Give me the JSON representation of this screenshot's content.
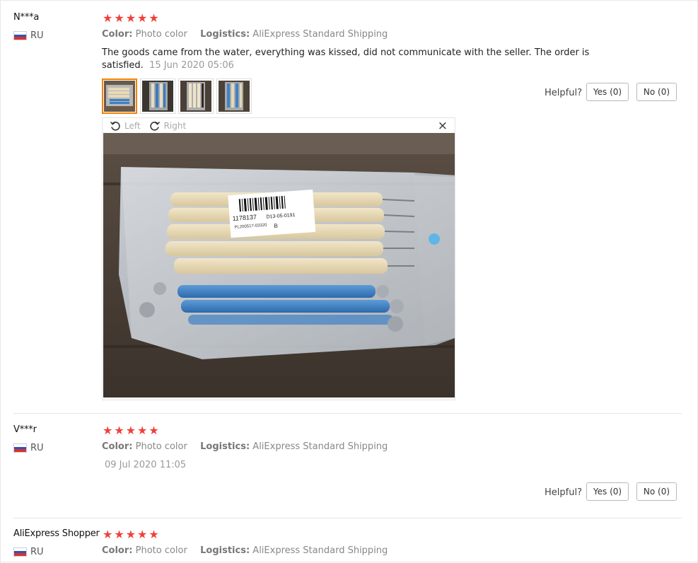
{
  "labels": {
    "color": "Color:",
    "logistics": "Logistics:",
    "helpful": "Helpful?",
    "rotate_left": "Left",
    "rotate_right": "Right",
    "close": "×"
  },
  "reviews": [
    {
      "user": "N***a",
      "country": "RU",
      "rating": 5,
      "color_value": "Photo color",
      "logistics_value": "AliExpress Standard Shipping",
      "text": "The goods came from the water, everything was kissed, did not communicate with the seller. The order is satisfied.",
      "date": "15 Jun 2020 05:06",
      "yes": "Yes (0)",
      "no": "No (0)"
    },
    {
      "user": "V***r",
      "country": "RU",
      "rating": 5,
      "color_value": "Photo color",
      "logistics_value": "AliExpress Standard Shipping",
      "text": "",
      "date": "09 Jul 2020 11:05",
      "yes": "Yes (0)",
      "no": "No (0)"
    },
    {
      "user": "AliExpress Shopper",
      "country": "RU",
      "rating": 5,
      "color_value": "Photo color",
      "logistics_value": "AliExpress Standard Shipping"
    }
  ],
  "photo": {
    "barcode_text": "1178137",
    "label_code": "D13-05-0191",
    "label_sub": "PL200517-03320",
    "label_letter": "B"
  }
}
